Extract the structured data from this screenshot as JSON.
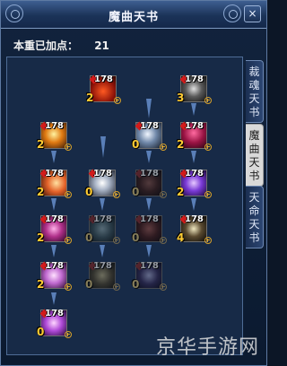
{
  "window": {
    "title": "魔曲天书",
    "close_label": "×"
  },
  "points": {
    "label": "本重已加点：",
    "value": "21"
  },
  "tabs": [
    {
      "label": [
        "裁",
        "魂",
        "天",
        "书"
      ],
      "active": false
    },
    {
      "label": [
        "魔",
        "曲",
        "天",
        "书"
      ],
      "active": true
    },
    {
      "label": [
        "天",
        "命",
        "天",
        "书"
      ],
      "active": false
    }
  ],
  "skills": [
    {
      "level": "178",
      "rank": "2",
      "dim": false
    },
    {
      "level": "178",
      "rank": "3",
      "dim": false
    },
    {
      "level": "178",
      "rank": "2",
      "dim": false
    },
    {
      "level": "178",
      "rank": "0",
      "dim": false
    },
    {
      "level": "178",
      "rank": "2",
      "dim": false
    },
    {
      "level": "178",
      "rank": "2",
      "dim": false
    },
    {
      "level": "178",
      "rank": "0",
      "dim": false
    },
    {
      "level": "178",
      "rank": "0",
      "dim": true
    },
    {
      "level": "178",
      "rank": "2",
      "dim": false
    },
    {
      "level": "178",
      "rank": "2",
      "dim": false
    },
    {
      "level": "178",
      "rank": "0",
      "dim": true
    },
    {
      "level": "178",
      "rank": "0",
      "dim": true
    },
    {
      "level": "178",
      "rank": "4",
      "dim": false
    },
    {
      "level": "178",
      "rank": "2",
      "dim": false
    },
    {
      "level": "178",
      "rank": "0",
      "dim": true
    },
    {
      "level": "178",
      "rank": "0",
      "dim": true
    },
    {
      "level": "178",
      "rank": "0",
      "dim": false
    }
  ],
  "watermark": "京华手游网",
  "colors": {
    "title_bg": "#1b3358",
    "panel_bg": "#172a47",
    "rank": "#ffcc33",
    "gem": "#d21b1b",
    "arrow": "#5a7fb8"
  }
}
